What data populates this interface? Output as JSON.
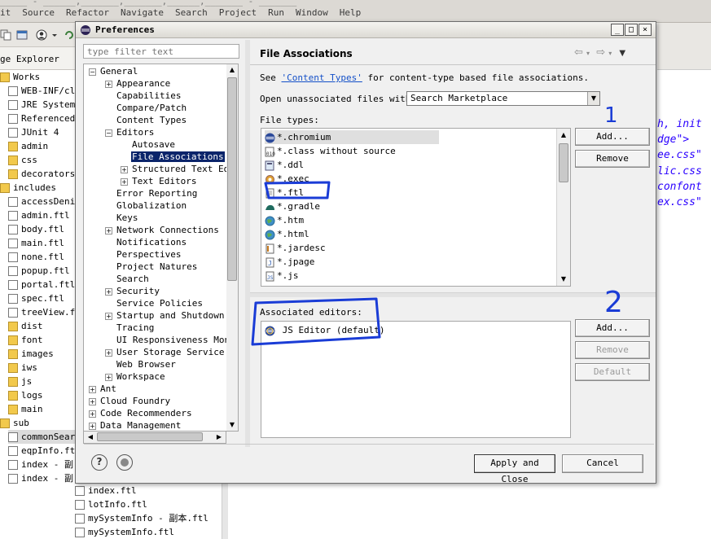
{
  "ide": {
    "title_fragment": "_____  -  ______,_______,_______,______,_______  -  _______",
    "menu": [
      "it",
      "Source",
      "Refactor",
      "Navigate",
      "Search",
      "Project",
      "Run",
      "Window",
      "Help"
    ],
    "pkg_explorer_title": "ge Explorer",
    "pkg_tree": [
      "Works",
      "WEB-INF/classe",
      "JRE System Lib",
      "Referenced Lib",
      "JUnit 4",
      "admin",
      "css",
      "decorators",
      "includes",
      "accessDenie",
      "admin.ftl",
      "body.ftl",
      "main.ftl",
      "none.ftl",
      "popup.ftl",
      "portal.ftl",
      "spec.ftl",
      "treeView.ft",
      "dist",
      "font",
      "images",
      "iws",
      "js",
      "logs",
      "main",
      "sub",
      "commonSearc",
      "eqpInfo.ftl",
      "index - 副",
      "index - 副",
      "index.ftl",
      "lotInfo.ftl",
      "mySystemInfo - 副本.ftl",
      "mySystemInfo.ftl"
    ],
    "editor_lines": [
      "h, init",
      "dge\">",
      "ee.css\"",
      "lic.css",
      "confont",
      "ex.css\""
    ]
  },
  "dialog": {
    "title": "Preferences",
    "filter_placeholder": "type filter text",
    "nav_tree": [
      {
        "label": "General",
        "expander": "−",
        "level": 0
      },
      {
        "label": "Appearance",
        "expander": "+",
        "level": 1
      },
      {
        "label": "Capabilities",
        "expander": "",
        "level": 1
      },
      {
        "label": "Compare/Patch",
        "expander": "",
        "level": 1
      },
      {
        "label": "Content Types",
        "expander": "",
        "level": 1
      },
      {
        "label": "Editors",
        "expander": "−",
        "level": 1
      },
      {
        "label": "Autosave",
        "expander": "",
        "level": 2
      },
      {
        "label": "File Associations",
        "expander": "",
        "level": 2,
        "selected": true
      },
      {
        "label": "Structured Text Edi",
        "expander": "+",
        "level": 2
      },
      {
        "label": "Text Editors",
        "expander": "+",
        "level": 2
      },
      {
        "label": "Error Reporting",
        "expander": "",
        "level": 1
      },
      {
        "label": "Globalization",
        "expander": "",
        "level": 1
      },
      {
        "label": "Keys",
        "expander": "",
        "level": 1
      },
      {
        "label": "Network Connections",
        "expander": "+",
        "level": 1
      },
      {
        "label": "Notifications",
        "expander": "",
        "level": 1
      },
      {
        "label": "Perspectives",
        "expander": "",
        "level": 1
      },
      {
        "label": "Project Natures",
        "expander": "",
        "level": 1
      },
      {
        "label": "Search",
        "expander": "",
        "level": 1
      },
      {
        "label": "Security",
        "expander": "+",
        "level": 1
      },
      {
        "label": "Service Policies",
        "expander": "",
        "level": 1
      },
      {
        "label": "Startup and Shutdown",
        "expander": "+",
        "level": 1
      },
      {
        "label": "Tracing",
        "expander": "",
        "level": 1
      },
      {
        "label": "UI Responsiveness Moni",
        "expander": "",
        "level": 1
      },
      {
        "label": "User Storage Service",
        "expander": "+",
        "level": 1
      },
      {
        "label": "Web Browser",
        "expander": "",
        "level": 1
      },
      {
        "label": "Workspace",
        "expander": "+",
        "level": 1
      },
      {
        "label": "Ant",
        "expander": "+",
        "level": 0
      },
      {
        "label": "Cloud Foundry",
        "expander": "+",
        "level": 0
      },
      {
        "label": "Code Recommenders",
        "expander": "+",
        "level": 0
      },
      {
        "label": "Data Management",
        "expander": "+",
        "level": 0
      }
    ],
    "page_title": "File Associations",
    "see_prefix": "See ",
    "see_link": "'Content Types'",
    "see_suffix": " for content-type based file associations.",
    "open_unassociated_label": "Open unassociated files with:",
    "open_unassociated_value": "Search Marketplace",
    "file_types_label": "File types:",
    "file_types": [
      {
        "label": "*.chromium",
        "icon": "eclipse-icon",
        "selected": true
      },
      {
        "label": "*.class without source",
        "icon": "class-file-icon"
      },
      {
        "label": "*.ddl",
        "icon": "ddl-file-icon"
      },
      {
        "label": "*.exec",
        "icon": "exec-file-icon"
      },
      {
        "label": "*.ftl",
        "icon": "text-file-icon"
      },
      {
        "label": "*.gradle",
        "icon": "gradle-icon"
      },
      {
        "label": "*.htm",
        "icon": "globe-icon"
      },
      {
        "label": "*.html",
        "icon": "globe-icon"
      },
      {
        "label": "*.jardesc",
        "icon": "jar-file-icon"
      },
      {
        "label": "*.jpage",
        "icon": "jpage-file-icon"
      },
      {
        "label": "*.js",
        "icon": "js-file-icon"
      }
    ],
    "add_label": "Add...",
    "remove_label": "Remove",
    "associated_editors_label": "Associated editors:",
    "associated_editors": [
      {
        "label": "JS Editor (default)",
        "icon": "eclipse-icon"
      }
    ],
    "editor_add_label": "Add...",
    "editor_remove_label": "Remove",
    "editor_default_label": "Default",
    "apply_close_label": "Apply and Close",
    "cancel_label": "Cancel",
    "help_glyph": "?",
    "win_min": "_",
    "win_max": "□",
    "win_close": "×"
  },
  "annotations": {
    "mark1": "1",
    "mark2": "2",
    "color": "#1a3cd6"
  }
}
